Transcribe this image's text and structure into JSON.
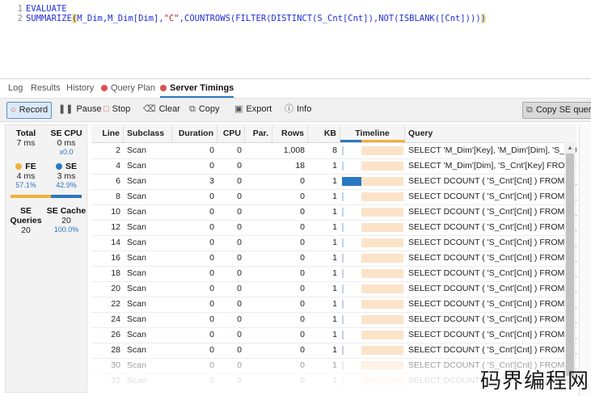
{
  "editor": {
    "lines": [
      {
        "num": "1",
        "text": "EVALUATE"
      },
      {
        "num": "2",
        "pre": "SUMMARIZE",
        "open": "(",
        "mid1": "M_Dim,M_Dim[Dim],",
        "str": "\"C\"",
        "mid2": ",COUNTROWS(FILTER(DISTINCT(S_Cnt[Cnt]),NOT(ISBLANK([Cnt])))",
        "close": ")"
      }
    ]
  },
  "tabs": [
    {
      "label": "Log"
    },
    {
      "label": "Results"
    },
    {
      "label": "History"
    },
    {
      "label": "Query Plan"
    },
    {
      "label": "Server Timings"
    }
  ],
  "toolbar": {
    "record": "Record",
    "pause": "Pause",
    "stop": "Stop",
    "clear": "Clear",
    "copy": "Copy",
    "export": "Export",
    "info": "Info",
    "copy_se": "Copy SE query"
  },
  "stats": {
    "total_label": "Total",
    "total_value": "7 ms",
    "secpu_label": "SE CPU",
    "secpu_value": "0 ms",
    "secpu_ratio": "x0.0",
    "fe_label": "FE",
    "fe_value": "4 ms",
    "fe_pct": "57.1%",
    "se_label": "SE",
    "se_value": "3 ms",
    "se_pct": "42.9%",
    "fe_fraction": 0.571,
    "sequeries_label": "SE Queries",
    "sequeries_value": "20",
    "secache_label": "SE Cache",
    "secache_value": "20",
    "secache_pct": "100.0%"
  },
  "grid": {
    "headers": {
      "line": "Line",
      "subclass": "Subclass",
      "duration": "Duration",
      "cpu": "CPU",
      "par": "Par.",
      "rows": "Rows",
      "kb": "KB",
      "timeline": "Timeline",
      "query": "Query"
    },
    "rows": [
      {
        "line": "2",
        "subclass": "Scan",
        "duration": "0",
        "cpu": "0",
        "par": "",
        "rows": "1,008",
        "kb": "8",
        "query": "SELECT 'M_Dim'[Key], 'M_Dim'[Dim], 'S_Cnt'",
        "tl": 0.0
      },
      {
        "line": "4",
        "subclass": "Scan",
        "duration": "0",
        "cpu": "0",
        "par": "",
        "rows": "18",
        "kb": "1",
        "query": "SELECT 'M_Dim'[Dim], 'S_Cnt'[Key] FROM 'S",
        "tl": 0.0
      },
      {
        "line": "6",
        "subclass": "Scan",
        "duration": "3",
        "cpu": "0",
        "par": "",
        "rows": "0",
        "kb": "1",
        "query": "SELECT DCOUNT ( 'S_Cnt'[Cnt] ) FROM 'S_C",
        "tl": 1.0
      },
      {
        "line": "8",
        "subclass": "Scan",
        "duration": "0",
        "cpu": "0",
        "par": "",
        "rows": "0",
        "kb": "1",
        "query": "SELECT DCOUNT ( 'S_Cnt'[Cnt] ) FROM 'S_C",
        "tl": 0.0
      },
      {
        "line": "10",
        "subclass": "Scan",
        "duration": "0",
        "cpu": "0",
        "par": "",
        "rows": "0",
        "kb": "1",
        "query": "SELECT DCOUNT ( 'S_Cnt'[Cnt] ) FROM 'S_C",
        "tl": 0.0
      },
      {
        "line": "12",
        "subclass": "Scan",
        "duration": "0",
        "cpu": "0",
        "par": "",
        "rows": "0",
        "kb": "1",
        "query": "SELECT DCOUNT ( 'S_Cnt'[Cnt] ) FROM 'S_C",
        "tl": 0.0
      },
      {
        "line": "14",
        "subclass": "Scan",
        "duration": "0",
        "cpu": "0",
        "par": "",
        "rows": "0",
        "kb": "1",
        "query": "SELECT DCOUNT ( 'S_Cnt'[Cnt] ) FROM 'S_C",
        "tl": 0.0
      },
      {
        "line": "16",
        "subclass": "Scan",
        "duration": "0",
        "cpu": "0",
        "par": "",
        "rows": "0",
        "kb": "1",
        "query": "SELECT DCOUNT ( 'S_Cnt'[Cnt] ) FROM 'S_C",
        "tl": 0.0
      },
      {
        "line": "18",
        "subclass": "Scan",
        "duration": "0",
        "cpu": "0",
        "par": "",
        "rows": "0",
        "kb": "1",
        "query": "SELECT DCOUNT ( 'S_Cnt'[Cnt] ) FROM 'S_C",
        "tl": 0.0
      },
      {
        "line": "20",
        "subclass": "Scan",
        "duration": "0",
        "cpu": "0",
        "par": "",
        "rows": "0",
        "kb": "1",
        "query": "SELECT DCOUNT ( 'S_Cnt'[Cnt] ) FROM 'S_C",
        "tl": 0.0
      },
      {
        "line": "22",
        "subclass": "Scan",
        "duration": "0",
        "cpu": "0",
        "par": "",
        "rows": "0",
        "kb": "1",
        "query": "SELECT DCOUNT ( 'S_Cnt'[Cnt] ) FROM 'S_C",
        "tl": 0.0
      },
      {
        "line": "24",
        "subclass": "Scan",
        "duration": "0",
        "cpu": "0",
        "par": "",
        "rows": "0",
        "kb": "1",
        "query": "SELECT DCOUNT ( 'S_Cnt'[Cnt] ) FROM 'S_C",
        "tl": 0.0
      },
      {
        "line": "26",
        "subclass": "Scan",
        "duration": "0",
        "cpu": "0",
        "par": "",
        "rows": "0",
        "kb": "1",
        "query": "SELECT DCOUNT ( 'S_Cnt'[Cnt] ) FROM 'S_C",
        "tl": 0.0
      },
      {
        "line": "28",
        "subclass": "Scan",
        "duration": "0",
        "cpu": "0",
        "par": "",
        "rows": "0",
        "kb": "1",
        "query": "SELECT DCOUNT ( 'S_Cnt'[Cnt] ) FROM 'S_C",
        "tl": 0.0
      },
      {
        "line": "30",
        "subclass": "Scan",
        "duration": "0",
        "cpu": "0",
        "par": "",
        "rows": "0",
        "kb": "1",
        "query": "SELECT DCOUNT ( 'S_Cnt'[Cnt] ) FROM 'S_C",
        "tl": 0.0
      },
      {
        "line": "32",
        "subclass": "Scan",
        "duration": "0",
        "cpu": "0",
        "par": "",
        "rows": "0",
        "kb": "1",
        "query": "SELECT DCOUNT ( 'S_Cnt'[Cnt] ) FROM 'S_C",
        "tl": 0.0
      }
    ]
  },
  "colors": {
    "accent": "#2b78c2",
    "fe": "#f0b23c",
    "se": "#2b78c2",
    "timeline_bg": "#fbe3c9",
    "record_dot": "#d9534f"
  },
  "watermark": "码界编程网"
}
